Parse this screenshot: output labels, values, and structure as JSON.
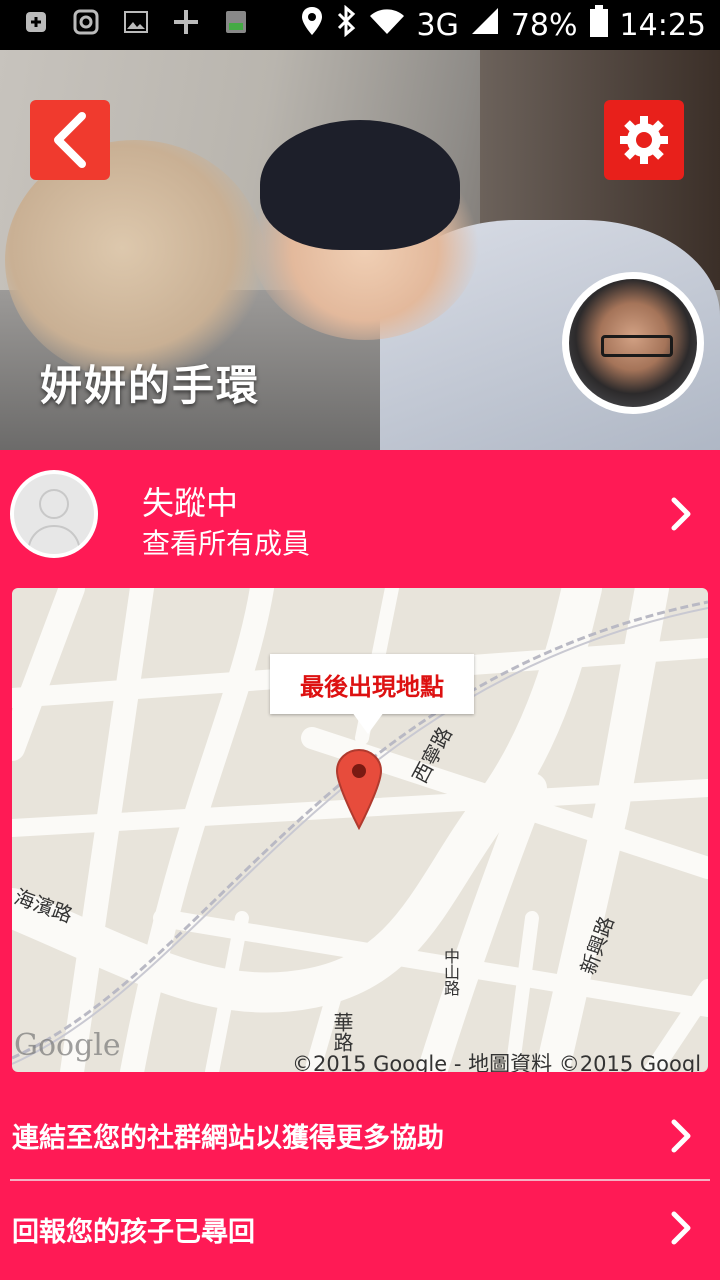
{
  "status_bar": {
    "network": "3G",
    "battery": "78%",
    "time": "14:25"
  },
  "header": {
    "title": "妍妍的手環"
  },
  "member": {
    "status": "失蹤中",
    "link": "查看所有成員"
  },
  "map": {
    "callout": "最後出現地點",
    "road_labels": [
      "西寧路",
      "海濱路",
      "中山路",
      "新興路",
      "華路"
    ],
    "copyright": "©2015 Google - 地圖資料 ©2015 Googl",
    "logo": "Google"
  },
  "actions": [
    {
      "label": "連結至您的社群網站以獲得更多協助"
    },
    {
      "label": "回報您的孩子已尋回"
    }
  ],
  "colors": {
    "accent": "#ff1a55",
    "button_red": "#f03a2e",
    "callout_text": "#dd1111"
  }
}
